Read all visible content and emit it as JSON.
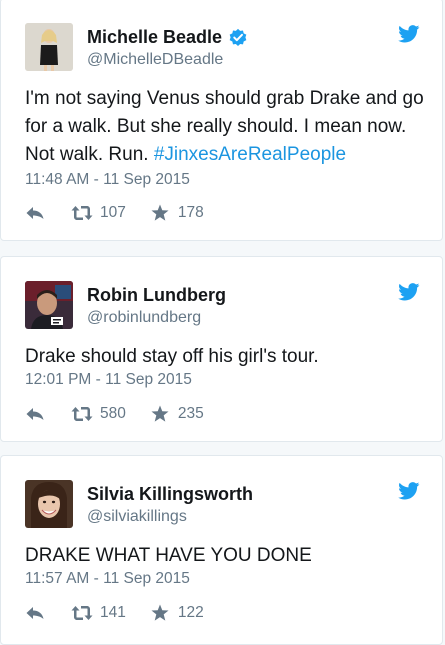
{
  "colors": {
    "twitter_blue": "#1da1f2",
    "text_primary": "#14171a",
    "text_secondary": "#657786",
    "hashtag": "#1b95e0",
    "icon_grey": "#657786"
  },
  "tweets": [
    {
      "name": "Michelle Beadle",
      "verified": true,
      "handle": "@MichelleDBeadle",
      "text": "I'm not saying Venus should grab Drake and go for a walk. But she really should. I mean now. Not walk.  Run. ",
      "hashtag": "#JinxesAreRealPeople",
      "timestamp": "11:48 AM - 11 Sep 2015",
      "retweets": "107",
      "likes": "178",
      "icons": [
        "reply-icon",
        "retweet-icon",
        "like-star-icon",
        "twitter-bird-icon",
        "verified-badge-icon"
      ]
    },
    {
      "name": "Robin Lundberg",
      "verified": false,
      "handle": "@robinlundberg",
      "text": "Drake should stay off his girl's tour.",
      "timestamp": "12:01 PM - 11 Sep 2015",
      "retweets": "580",
      "likes": "235",
      "icons": [
        "reply-icon",
        "retweet-icon",
        "like-star-icon",
        "twitter-bird-icon"
      ]
    },
    {
      "name": "Silvia Killingsworth",
      "verified": false,
      "handle": "@silviakillings",
      "text": "DRAKE WHAT HAVE YOU DONE",
      "timestamp": "11:57 AM - 11 Sep 2015",
      "retweets": "141",
      "likes": "122",
      "icons": [
        "reply-icon",
        "retweet-icon",
        "like-star-icon",
        "twitter-bird-icon"
      ]
    }
  ]
}
